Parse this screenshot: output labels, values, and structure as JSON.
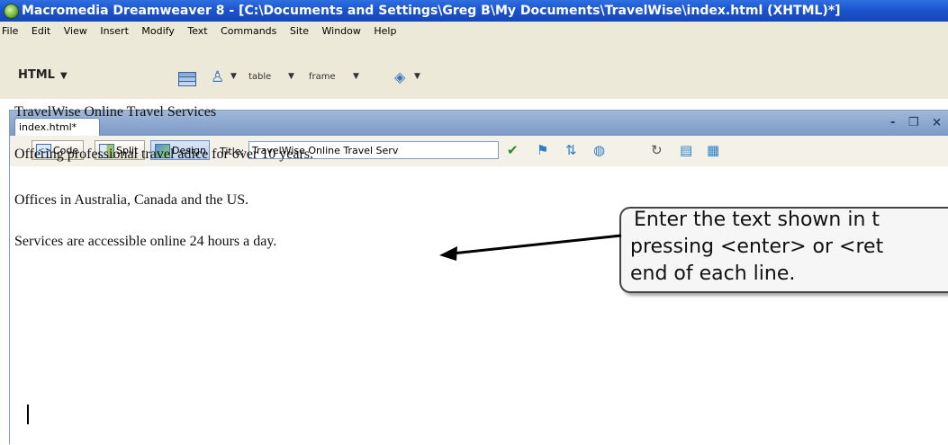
{
  "window": {
    "title": "Macromedia Dreamweaver 8 - [C:\\Documents and Settings\\Greg B\\My Documents\\TravelWise\\index.html (XHTML)*]"
  },
  "menu": {
    "items": [
      "File",
      "Edit",
      "View",
      "Insert",
      "Modify",
      "Text",
      "Commands",
      "Site",
      "Window",
      "Help"
    ]
  },
  "insert_bar": {
    "category": "HTML",
    "table_label": "table",
    "frame_label": "frame"
  },
  "document": {
    "tab_label": "index.html*",
    "window_controls": "- ❐ ×",
    "toolbar": {
      "code_label": "Code",
      "split_label": "Split",
      "design_label": "Design",
      "title_label": "Title:",
      "title_value": "TravelWise Online Travel Serv"
    },
    "paragraphs": [
      "TravelWise Online Travel Services",
      "Offering professional travel adice for over 10 years.",
      "Offices in Australia, Canada and the US.",
      "Services are accessible online 24 hours a day."
    ]
  },
  "callout": {
    "lines": [
      "Enter the text shown in t",
      "pressing <enter> or <ret",
      "end of each line."
    ]
  }
}
